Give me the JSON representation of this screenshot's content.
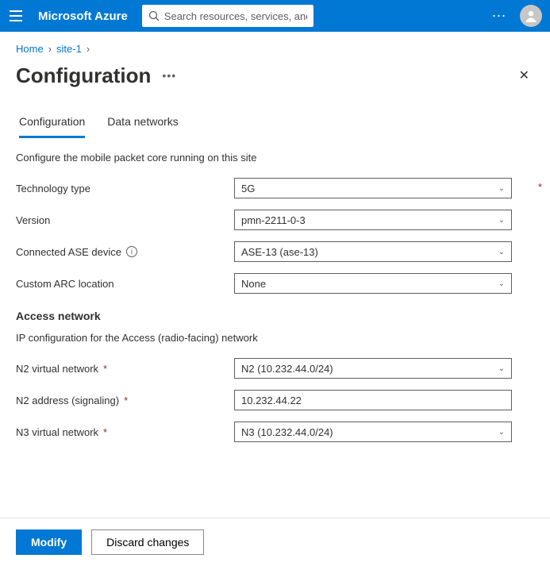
{
  "topbar": {
    "brand": "Microsoft Azure",
    "search_placeholder": "Search resources, services, and docs (G+/)"
  },
  "breadcrumb": {
    "items": [
      "Home",
      "site-1"
    ]
  },
  "page": {
    "title": "Configuration"
  },
  "tabs": [
    {
      "label": "Configuration",
      "active": true
    },
    {
      "label": "Data networks",
      "active": false
    }
  ],
  "main": {
    "description": "Configure the mobile packet core running on this site",
    "fields": {
      "technology_type": {
        "label": "Technology type",
        "value": "5G",
        "required_outside": true
      },
      "version": {
        "label": "Version",
        "value": "pmn-2211-0-3"
      },
      "connected_ase": {
        "label": "Connected ASE device",
        "value": "ASE-13 (ase-13)"
      },
      "custom_arc": {
        "label": "Custom ARC location",
        "value": "None"
      }
    },
    "access_network": {
      "heading": "Access network",
      "description": "IP configuration for the Access (radio-facing) network",
      "fields": {
        "n2_vnet": {
          "label": "N2 virtual network",
          "value": "N2 (10.232.44.0/24)",
          "required": true
        },
        "n2_addr": {
          "label": "N2 address (signaling)",
          "value": "10.232.44.22",
          "required": true
        },
        "n3_vnet": {
          "label": "N3 virtual network",
          "value": "N3 (10.232.44.0/24)",
          "required": true
        }
      }
    }
  },
  "footer": {
    "primary": "Modify",
    "secondary": "Discard changes"
  }
}
